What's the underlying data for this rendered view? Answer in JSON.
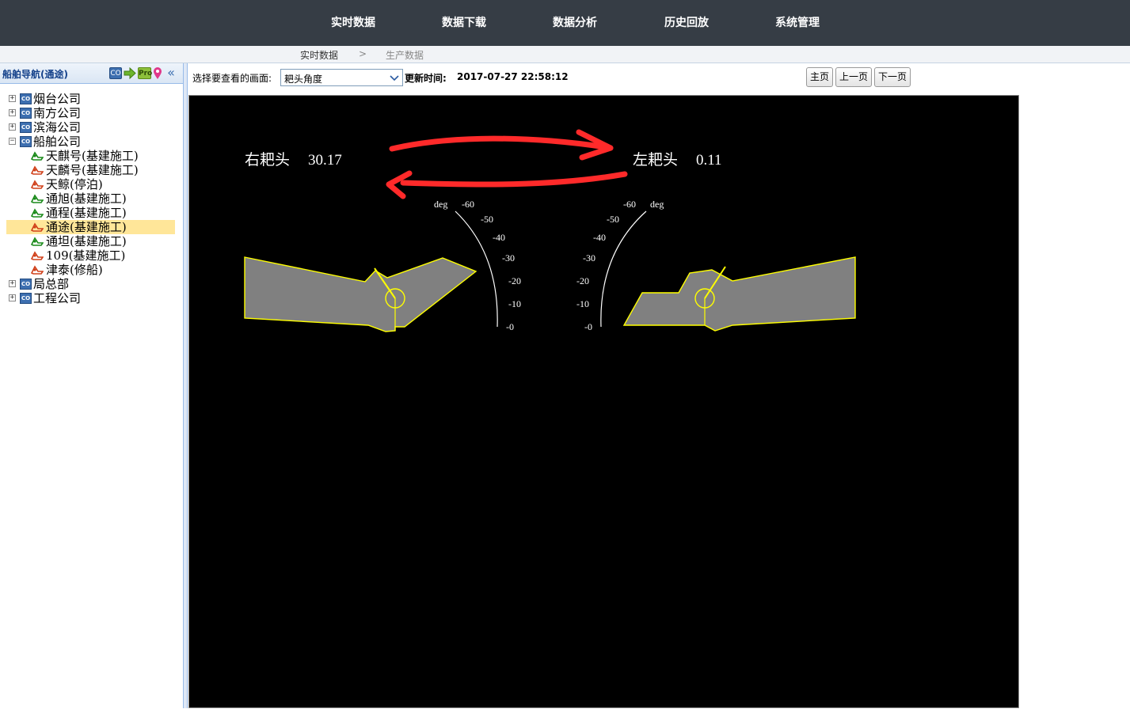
{
  "nav": {
    "items": [
      {
        "label": "实时数据"
      },
      {
        "label": "数据下载"
      },
      {
        "label": "数据分析"
      },
      {
        "label": "历史回放"
      },
      {
        "label": "系统管理"
      }
    ]
  },
  "breadcrumb": {
    "first": "实时数据",
    "separator": ">",
    "second": "生产数据"
  },
  "sidebar": {
    "title": "船舶导航(通途)",
    "header_icons": [
      "CO",
      "Pro"
    ],
    "collapse_glyph": "«",
    "tree": [
      {
        "label": "烟台公司",
        "type": "company",
        "expander": "+"
      },
      {
        "label": "南方公司",
        "type": "company",
        "expander": "+"
      },
      {
        "label": "滨海公司",
        "type": "company",
        "expander": "+"
      },
      {
        "label": "船舶公司",
        "type": "company",
        "expander": "−"
      },
      {
        "label": "天麒号(基建施工)",
        "type": "ship",
        "status": "green"
      },
      {
        "label": "天麟号(基建施工)",
        "type": "ship",
        "status": "red"
      },
      {
        "label": "天鲸(停泊)",
        "type": "ship",
        "status": "red"
      },
      {
        "label": "通旭(基建施工)",
        "type": "ship",
        "status": "green"
      },
      {
        "label": "通程(基建施工)",
        "type": "ship",
        "status": "green"
      },
      {
        "label": "通途(基建施工)",
        "type": "ship",
        "status": "red",
        "selected": true
      },
      {
        "label": "通坦(基建施工)",
        "type": "ship",
        "status": "green"
      },
      {
        "label": "109(基建施工)",
        "type": "ship",
        "status": "red"
      },
      {
        "label": "津泰(修船)",
        "type": "ship",
        "status": "red"
      },
      {
        "label": "局总部",
        "type": "company",
        "expander": "+"
      },
      {
        "label": "工程公司",
        "type": "company",
        "expander": "+"
      }
    ]
  },
  "toolbar": {
    "select_label": "选择要查看的画面:",
    "selected_view": "耙头角度",
    "update_label": "更新时间:",
    "update_time": "2017-07-27 22:58:12",
    "home_button": "主页",
    "prev_button": "上一页",
    "next_button": "下一页"
  },
  "display": {
    "right_head_label": "右耙头",
    "right_head_value": "30.17",
    "left_head_label": "左耙头",
    "left_head_value": "0.11",
    "gauge_unit": "deg",
    "gauge_ticks": [
      "-60",
      "-50",
      "-40",
      "-30",
      "-20",
      "-10",
      "-0"
    ]
  },
  "colors": {
    "nav_bg": "#363d45",
    "canvas_bg": "#000000",
    "arm_fill": "#808080",
    "arm_stroke": "#ffff00",
    "arrow_color": "#ff2a2a",
    "selected_row": "#ffe699"
  }
}
